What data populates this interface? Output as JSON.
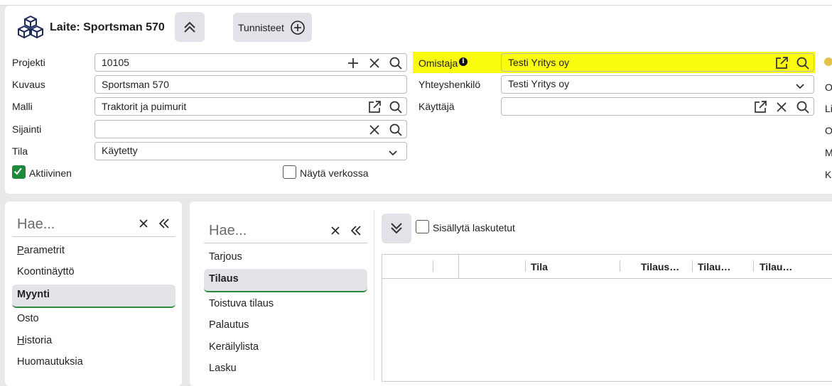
{
  "header": {
    "title": "Laite: Sportsman 570",
    "tags_label": "Tunnisteet"
  },
  "form": {
    "left": {
      "projekti": {
        "label": "Projekti",
        "value": "10105"
      },
      "kuvaus": {
        "label": "Kuvaus",
        "value": "Sportsman 570"
      },
      "malli": {
        "label": "Malli",
        "value": "Traktorit ja puimurit"
      },
      "sijainti": {
        "label": "Sijainti",
        "value": ""
      },
      "tila": {
        "label": "Tila",
        "value": "Käytetty"
      },
      "aktiivinen": {
        "label": "Aktiivinen",
        "checked": true
      },
      "nayta_verkossa": {
        "label": "Näytä verkossa",
        "checked": false
      }
    },
    "right": {
      "omistaja": {
        "label": "Omistaja",
        "value": "Testi Yritys oy"
      },
      "yhteyshenkilo": {
        "label": "Yhteyshenkilö",
        "value": "Testi Yritys oy"
      },
      "kayttaja": {
        "label": "Käyttäjä",
        "value": ""
      }
    },
    "cut_labels": [
      "O",
      "Li",
      "O",
      "M",
      "K"
    ]
  },
  "nav1": {
    "search_placeholder": "Hae...",
    "items": [
      {
        "pre": "",
        "ul": "P",
        "rest": "arametrit"
      },
      {
        "pre": "",
        "ul": "",
        "rest": "Koontinäyttö"
      },
      {
        "pre": "",
        "ul": "",
        "rest": "Myynti"
      },
      {
        "pre": "",
        "ul": "",
        "rest": "Osto"
      },
      {
        "pre": "",
        "ul": "H",
        "rest": "istoria"
      },
      {
        "pre": "",
        "ul": "",
        "rest": "Huomautuksia"
      }
    ],
    "selected_index": 2
  },
  "nav2": {
    "search_placeholder": "Hae...",
    "items": [
      {
        "pre": "Tar",
        "ul": "j",
        "rest": "ous"
      },
      {
        "pre": "",
        "ul": "",
        "rest": "Tilaus"
      },
      {
        "pre": "",
        "ul": "",
        "rest": "Toistuva tilaus"
      },
      {
        "pre": "",
        "ul": "",
        "rest": "Palautus"
      },
      {
        "pre": "",
        "ul": "",
        "rest": "Keräilylista"
      },
      {
        "pre": "",
        "ul": "",
        "rest": "Lasku"
      }
    ],
    "selected_index": 1
  },
  "grid": {
    "include_invoiced_label": "Sisällytä laskutetut",
    "include_invoiced_checked": false,
    "columns": [
      "Tila",
      "Tilaus…",
      "Tilau…",
      "Tilau…"
    ]
  },
  "colors": {
    "highlight": "#fbfb0f",
    "accent_green": "#1e8a3b",
    "button_bg": "#e1e3e8",
    "status_dot": "#e2c24a"
  }
}
